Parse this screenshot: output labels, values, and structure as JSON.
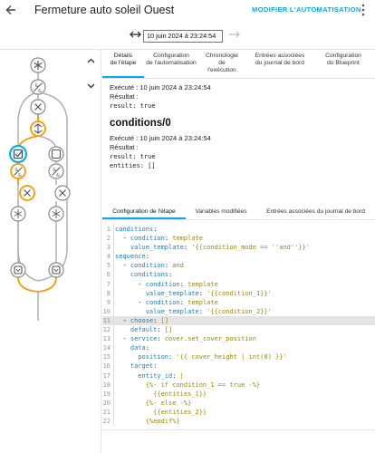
{
  "header": {
    "back_icon": "arrow-left-icon",
    "title": "Fermeture auto soleil Ouest",
    "modify_label": "MODIFIER L'AUTOMATISATION",
    "menu_icon": "dots-vertical-icon"
  },
  "timeline": {
    "date": "10 juin 2024 à 23:24:54",
    "prev_icon": "arrow-left-right-icon",
    "next_icon": "arrow-right-icon"
  },
  "tabs_top": [
    "Détails\nde l'étape",
    "Configuration\nde l'automatisation",
    "Chronologie\nde\nl'exécution",
    "Entrées associées\ndu journal de bord",
    "Configuration\ndu Blueprint"
  ],
  "trace": {
    "executed_1": "Exécuté : 10 juin 2024 à 23:24:54",
    "result_label_1": "Résultat :",
    "result_value_1": "result: true",
    "section_title": "conditions/0",
    "executed_2": "Exécuté : 10 juin 2024 à 23:24:54",
    "result_label_2": "Résultat :",
    "result_value_2a": "result: true",
    "result_value_2b": "entities: []"
  },
  "tabs_bottom": [
    "Configuration de l'étape",
    "Variables modifiées",
    "Entrées associées du journal de bord"
  ],
  "code_lines": [
    {
      "n": "1",
      "t": "conditions:"
    },
    {
      "n": "2",
      "t": "  - condition: template"
    },
    {
      "n": "3",
      "t": "    value_template: '{{condition_mode == ''and''}}'"
    },
    {
      "n": "4",
      "t": "sequence:"
    },
    {
      "n": "5",
      "t": "  - condition: and"
    },
    {
      "n": "6",
      "t": "    conditions:"
    },
    {
      "n": "7",
      "t": "      - condition: template"
    },
    {
      "n": "8",
      "t": "        value_template: '{{condition_1}}'"
    },
    {
      "n": "9",
      "t": "      - condition: template"
    },
    {
      "n": "10",
      "t": "        value_template: '{{condition_2}}'"
    },
    {
      "n": "11",
      "t": "  - choose: []"
    },
    {
      "n": "12",
      "t": "    default: []"
    },
    {
      "n": "13",
      "t": "  - service: cover.set_cover_position"
    },
    {
      "n": "14",
      "t": "    data:"
    },
    {
      "n": "15",
      "t": "      position: '{{ cover_height | int(0) }}'"
    },
    {
      "n": "16",
      "t": "    target:"
    },
    {
      "n": "17",
      "t": "      entity_id: |"
    },
    {
      "n": "18",
      "t": "        {%- if condition_1 == true -%}"
    },
    {
      "n": "19",
      "t": "          {{entities_1}}"
    },
    {
      "n": "20",
      "t": "        {%- else -%}"
    },
    {
      "n": "21",
      "t": "          {{entities_2}}"
    },
    {
      "n": "22",
      "t": "        {%endif%}"
    }
  ],
  "highlighted_line": "11",
  "colors": {
    "accent": "#03a9f4",
    "active_path": "#ff9800",
    "inactive_path": "#b0b0b0"
  },
  "graph_icons": [
    "asterisk-icon",
    "and-condition-icon",
    "close-circle-icon",
    "choose-split-icon",
    "checkbox-icon",
    "stop-square-icon",
    "and-condition-icon",
    "and-condition-icon",
    "close-circle-icon",
    "asterisk-icon",
    "asterisk-icon",
    "service-icon",
    "service-icon"
  ]
}
